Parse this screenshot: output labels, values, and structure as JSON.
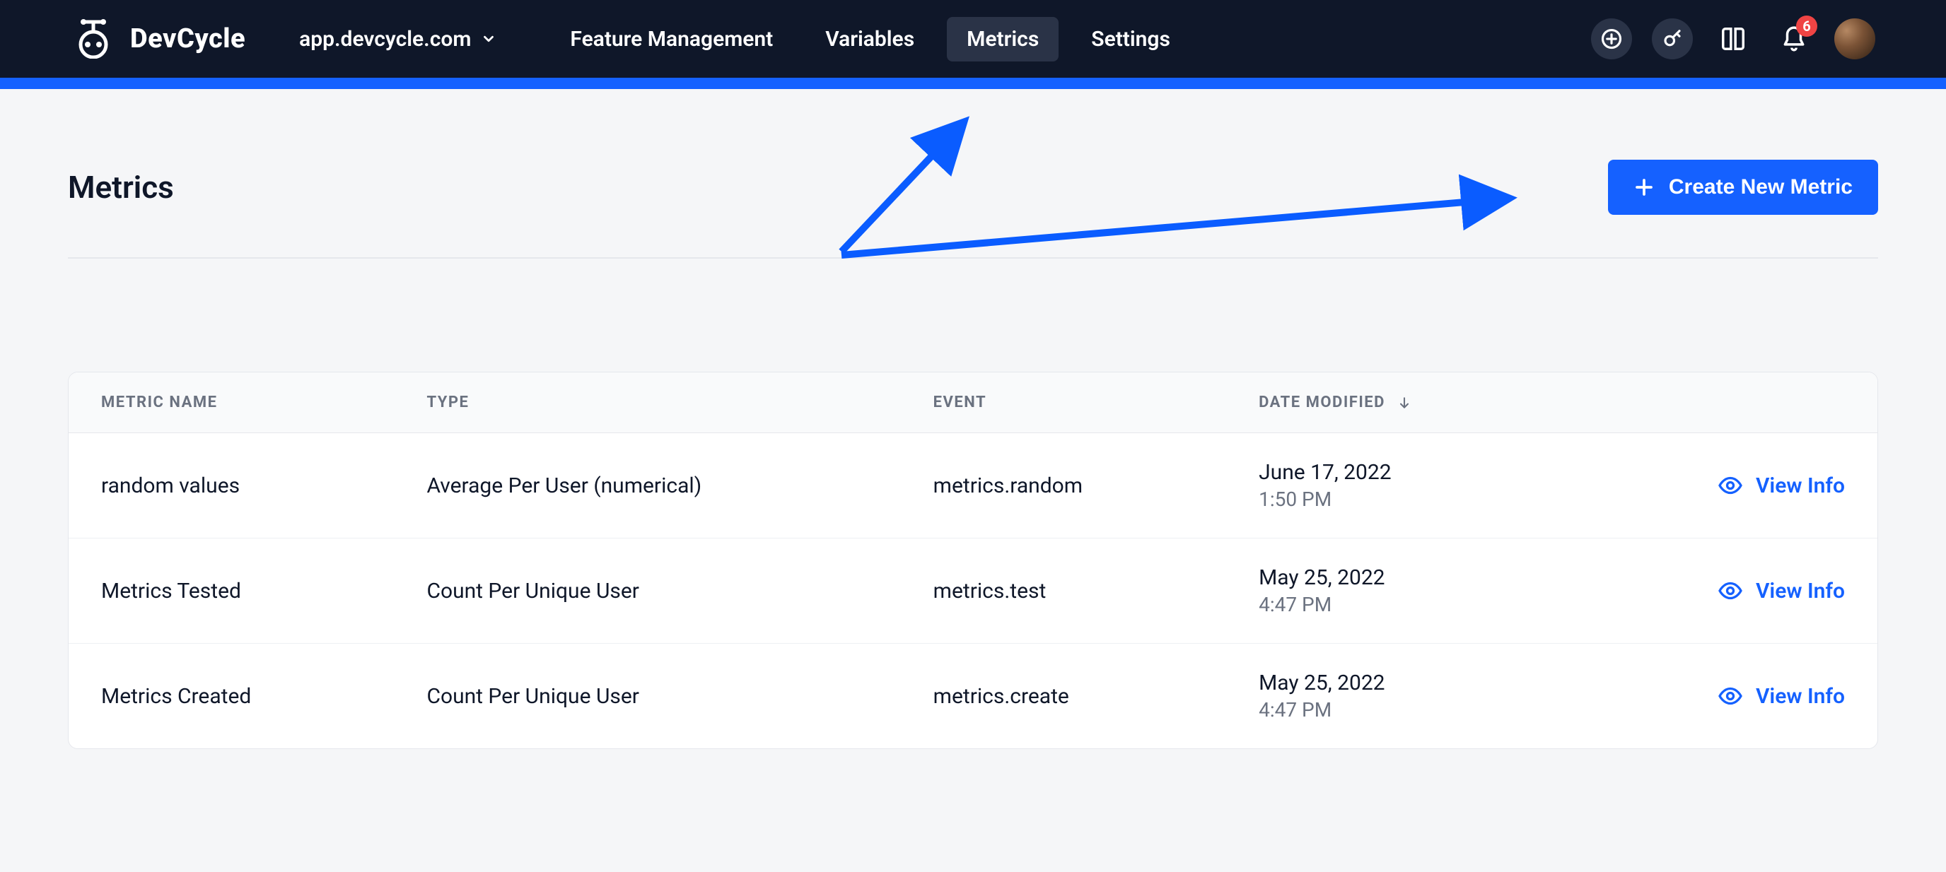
{
  "header": {
    "brand": "DevCycle",
    "project_label": "app.devcycle.com",
    "nav": [
      {
        "label": "Feature Management",
        "active": false
      },
      {
        "label": "Variables",
        "active": false
      },
      {
        "label": "Metrics",
        "active": true
      },
      {
        "label": "Settings",
        "active": false
      }
    ],
    "notification_count": "6"
  },
  "page": {
    "title": "Metrics",
    "create_button": "Create New Metric"
  },
  "table": {
    "columns": {
      "name": "METRIC NAME",
      "type": "TYPE",
      "event": "EVENT",
      "date_modified": "DATE MODIFIED"
    },
    "view_label": "View Info",
    "rows": [
      {
        "name": "random values",
        "type": "Average Per User (numerical)",
        "event": "metrics.random",
        "date": "June 17, 2022",
        "time": "1:50 PM"
      },
      {
        "name": "Metrics Tested",
        "type": "Count Per Unique User",
        "event": "metrics.test",
        "date": "May 25, 2022",
        "time": "4:47 PM"
      },
      {
        "name": "Metrics Created",
        "type": "Count Per Unique User",
        "event": "metrics.create",
        "date": "May 25, 2022",
        "time": "4:47 PM"
      }
    ]
  }
}
